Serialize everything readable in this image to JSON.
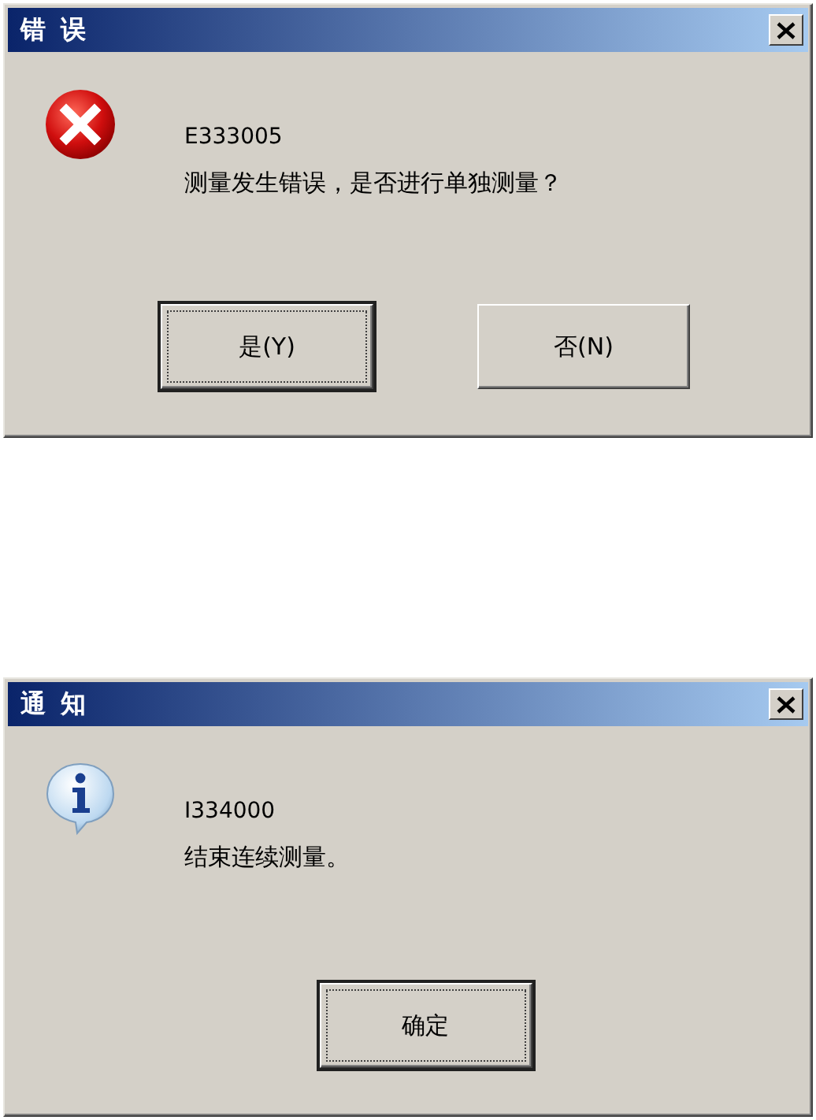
{
  "dialogs": [
    {
      "kind": "error",
      "title": "错 误",
      "code": "E333005",
      "message": "测量发生错误，是否进行单独测量？",
      "buttons": [
        {
          "label": "是(Y)",
          "default": true
        },
        {
          "label": "否(N)",
          "default": false
        }
      ]
    },
    {
      "kind": "info",
      "title": "通 知",
      "code": "I334000",
      "message": "结束连续测量。",
      "buttons": [
        {
          "label": "确定",
          "default": true
        }
      ]
    }
  ]
}
